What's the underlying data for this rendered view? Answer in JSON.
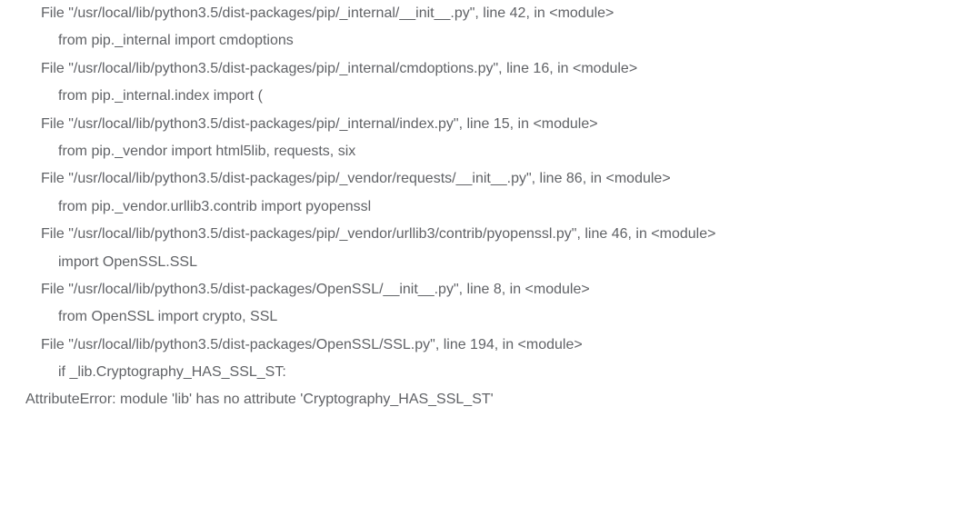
{
  "traceback": {
    "frames": [
      {
        "file": "File \"/usr/local/lib/python3.5/dist-packages/pip/_internal/__init__.py\", line 42, in <module>",
        "code": "from pip._internal import cmdoptions"
      },
      {
        "file": "File \"/usr/local/lib/python3.5/dist-packages/pip/_internal/cmdoptions.py\", line 16, in <module>",
        "code": "from pip._internal.index import ("
      },
      {
        "file": "File \"/usr/local/lib/python3.5/dist-packages/pip/_internal/index.py\", line 15, in <module>",
        "code": "from pip._vendor import html5lib, requests, six"
      },
      {
        "file": "File \"/usr/local/lib/python3.5/dist-packages/pip/_vendor/requests/__init__.py\", line 86, in <module>",
        "code": "from pip._vendor.urllib3.contrib import pyopenssl"
      },
      {
        "file": "File \"/usr/local/lib/python3.5/dist-packages/pip/_vendor/urllib3/contrib/pyopenssl.py\", line 46, in <module>",
        "code": "import OpenSSL.SSL"
      },
      {
        "file": "File \"/usr/local/lib/python3.5/dist-packages/OpenSSL/__init__.py\", line 8, in <module>",
        "code": "from OpenSSL import crypto, SSL"
      },
      {
        "file": "File \"/usr/local/lib/python3.5/dist-packages/OpenSSL/SSL.py\", line 194, in <module>",
        "code": "if _lib.Cryptography_HAS_SSL_ST:"
      }
    ],
    "error": "AttributeError: module 'lib' has no attribute 'Cryptography_HAS_SSL_ST'"
  }
}
